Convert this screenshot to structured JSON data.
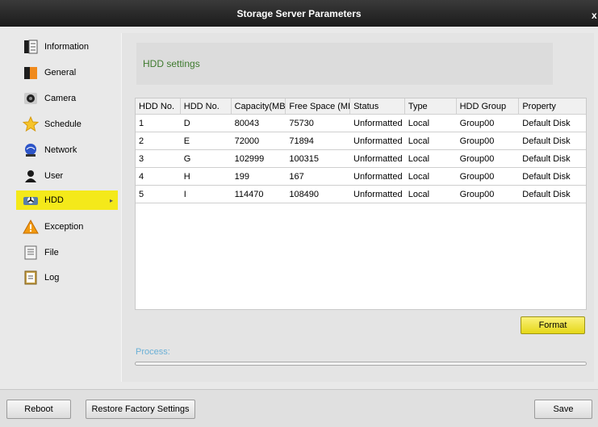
{
  "window": {
    "title": "Storage Server Parameters",
    "close_glyph": "x"
  },
  "sidebar": {
    "items": [
      {
        "label": "Information",
        "icon": "information-icon"
      },
      {
        "label": "General",
        "icon": "general-icon"
      },
      {
        "label": "Camera",
        "icon": "camera-icon"
      },
      {
        "label": "Schedule",
        "icon": "schedule-icon"
      },
      {
        "label": "Network",
        "icon": "network-icon"
      },
      {
        "label": "User",
        "icon": "user-icon"
      },
      {
        "label": "HDD",
        "icon": "hdd-icon",
        "active": true
      },
      {
        "label": "Exception",
        "icon": "exception-icon"
      },
      {
        "label": "File",
        "icon": "file-icon"
      },
      {
        "label": "Log",
        "icon": "log-icon"
      }
    ]
  },
  "main": {
    "section_title": "HDD settings",
    "table": {
      "columns": [
        "HDD No.",
        "HDD No.",
        "Capacity(MB)",
        "Free Space (MB)",
        "Status",
        "Type",
        "HDD Group",
        "Property"
      ],
      "rows": [
        [
          "1",
          "D",
          "80043",
          "75730",
          "Unformatted",
          "Local",
          "Group00",
          "Default Disk"
        ],
        [
          "2",
          "E",
          "72000",
          "71894",
          "Unformatted",
          "Local",
          "Group00",
          "Default Disk"
        ],
        [
          "3",
          "G",
          "102999",
          "100315",
          "Unformatted",
          "Local",
          "Group00",
          "Default Disk"
        ],
        [
          "4",
          "H",
          "199",
          "167",
          "Unformatted",
          "Local",
          "Group00",
          "Default Disk"
        ],
        [
          "5",
          "I",
          "114470",
          "108490",
          "Unformatted",
          "Local",
          "Group00",
          "Default Disk"
        ]
      ]
    },
    "format_label": "Format",
    "process_label": "Process:",
    "progress": 0
  },
  "footer": {
    "reboot_label": "Reboot",
    "restore_label": "Restore Factory Settings",
    "save_label": "Save"
  },
  "colors": {
    "accent": "#f4e91a",
    "section_title": "#3e7a2e",
    "process": "#6ab0d6"
  }
}
